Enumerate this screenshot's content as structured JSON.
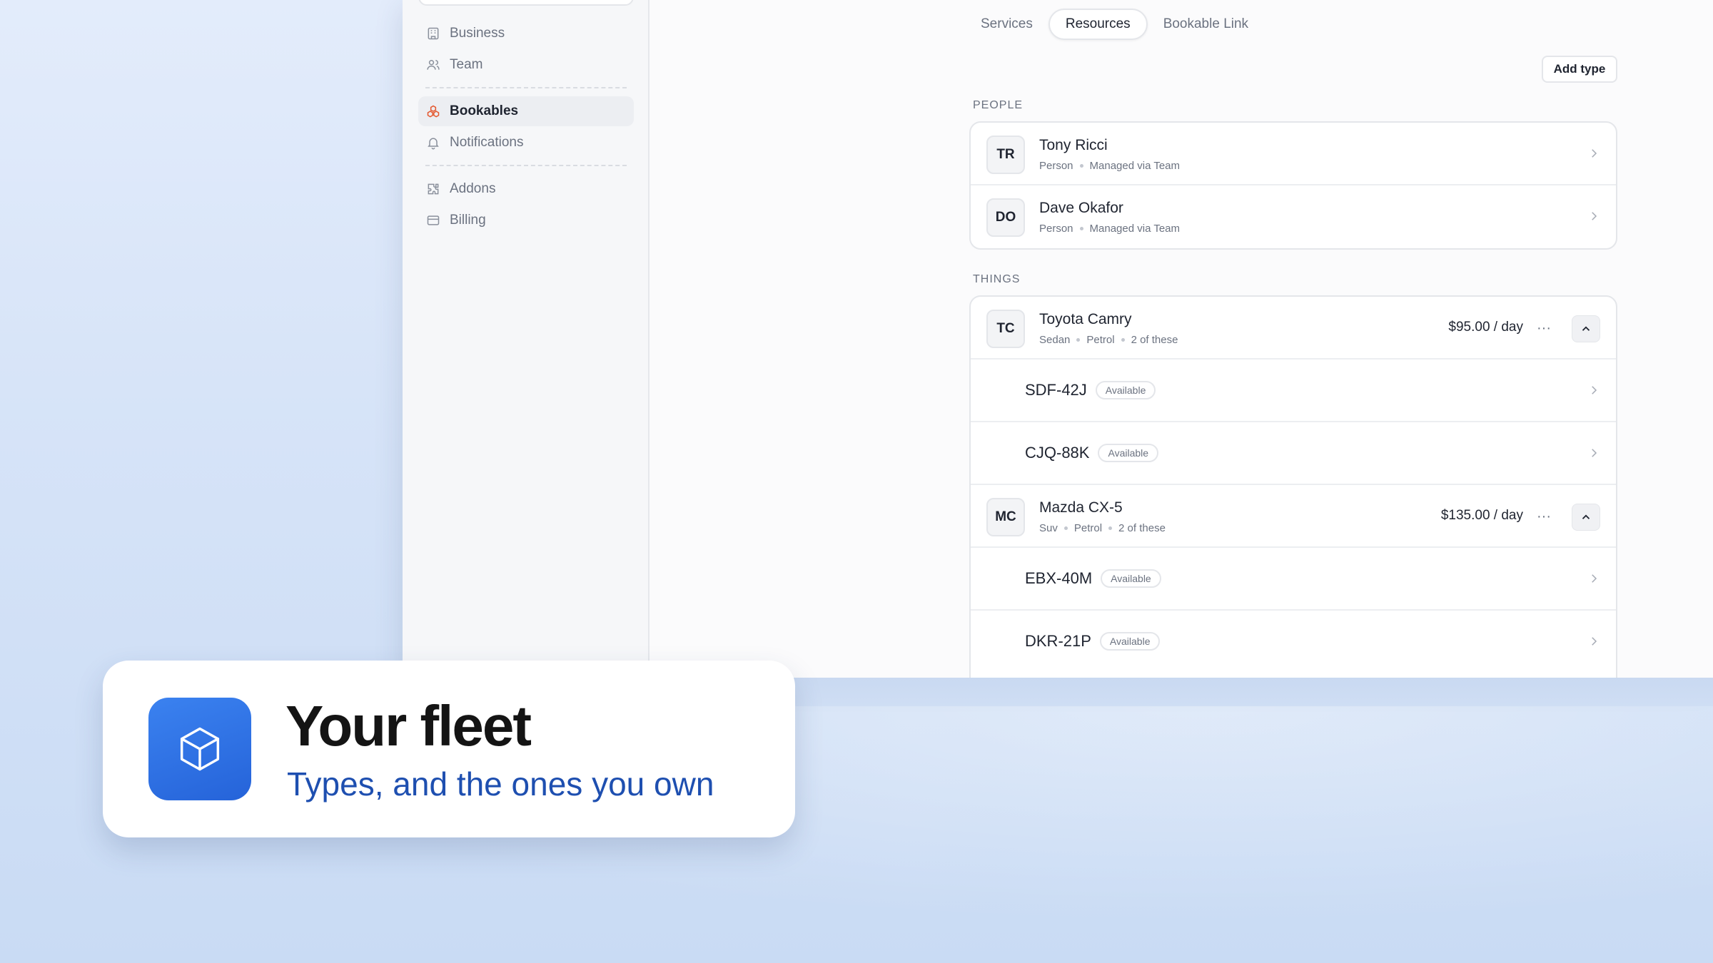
{
  "sidebar": {
    "items": [
      {
        "label": "Business",
        "icon": "building-icon"
      },
      {
        "label": "Team",
        "icon": "users-icon"
      },
      {
        "label": "Bookables",
        "icon": "boxes-icon",
        "active": true
      },
      {
        "label": "Notifications",
        "icon": "bell-icon"
      },
      {
        "label": "Addons",
        "icon": "puzzle-icon"
      },
      {
        "label": "Billing",
        "icon": "credit-card-icon"
      }
    ]
  },
  "tabs": [
    {
      "label": "Services"
    },
    {
      "label": "Resources",
      "active": true
    },
    {
      "label": "Bookable Link"
    }
  ],
  "actions": {
    "add_type": "Add type"
  },
  "people": {
    "label": "PEOPLE",
    "rows": [
      {
        "initials": "TR",
        "name": "Tony Ricci",
        "sub1": "Person",
        "sub2": "Managed via Team"
      },
      {
        "initials": "DO",
        "name": "Dave Okafor",
        "sub1": "Person",
        "sub2": "Managed via Team"
      }
    ]
  },
  "things": {
    "label": "THINGS",
    "types": [
      {
        "initials": "TC",
        "name": "Toyota Camry",
        "sub1": "Sedan",
        "sub2": "Petrol",
        "sub3": "2 of these",
        "price": "$95.00 / day",
        "more": "···",
        "units": [
          {
            "plate": "SDF-42J",
            "status": "Available"
          },
          {
            "plate": "CJQ-88K",
            "status": "Available"
          }
        ]
      },
      {
        "initials": "MC",
        "name": "Mazda CX-5",
        "sub1": "Suv",
        "sub2": "Petrol",
        "sub3": "2 of these",
        "price": "$135.00 / day",
        "more": "···",
        "units": [
          {
            "plate": "EBX-40M",
            "status": "Available"
          },
          {
            "plate": "DKR-21P",
            "status": "Available"
          }
        ]
      }
    ]
  },
  "caption": {
    "title": "Your fleet",
    "subtitle": "Types, and the ones you own",
    "icon": "cube-icon",
    "icon_color": "#2f6fe4"
  },
  "colors": {
    "accent": "#e4572e",
    "caption_sub": "#1e4fb0"
  }
}
